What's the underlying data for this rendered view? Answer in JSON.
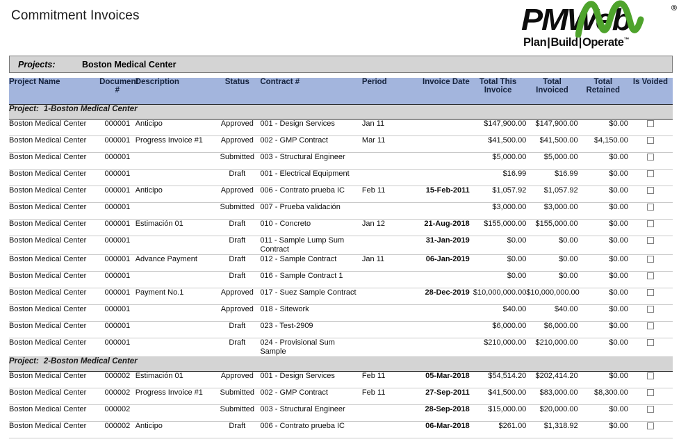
{
  "report": {
    "title": "Commitment Invoices"
  },
  "logo": {
    "wordmark": "PMWeb",
    "registered": "®",
    "tagline_plan": "Plan",
    "tagline_build": "Build",
    "tagline_operate": "Operate",
    "tagline_sep": "|",
    "trademark": "™"
  },
  "filter": {
    "label": "Projects:",
    "value": "Boston Medical Center"
  },
  "table": {
    "columns": [
      "Project Name",
      "Document #",
      "Description",
      "Status",
      "Contract #",
      "Period",
      "Invoice Date",
      "Total This Invoice",
      "Total Invoiced",
      "Total Retained",
      "Is Voided"
    ],
    "groups": [
      {
        "label": "Project:",
        "name": "1-Boston Medical Center",
        "rows": [
          {
            "project": "Boston Medical Center",
            "document": "000001",
            "description": "Anticipo",
            "status": "Approved",
            "contract": "001 - Design Services",
            "period": "Jan 11",
            "invoice_date": "",
            "total_this_invoice": "$147,900.00",
            "total_invoiced": "$147,900.00",
            "total_retained": "$0.00",
            "is_voided": false
          },
          {
            "project": "Boston Medical Center",
            "document": "000001",
            "description": "Progress Invoice #1",
            "status": "Approved",
            "contract": "002 - GMP Contract",
            "period": "Mar 11",
            "invoice_date": "",
            "total_this_invoice": "$41,500.00",
            "total_invoiced": "$41,500.00",
            "total_retained": "$4,150.00",
            "is_voided": false
          },
          {
            "project": "Boston Medical Center",
            "document": "000001",
            "description": "",
            "status": "Submitted",
            "contract": "003 - Structural Engineer",
            "period": "",
            "invoice_date": "",
            "total_this_invoice": "$5,000.00",
            "total_invoiced": "$5,000.00",
            "total_retained": "$0.00",
            "is_voided": false
          },
          {
            "project": "Boston Medical Center",
            "document": "000001",
            "description": "",
            "status": "Draft",
            "contract": "001 - Electrical Equipment",
            "period": "",
            "invoice_date": "",
            "total_this_invoice": "$16.99",
            "total_invoiced": "$16.99",
            "total_retained": "$0.00",
            "is_voided": false
          },
          {
            "project": "Boston Medical Center",
            "document": "000001",
            "description": "Anticipo",
            "status": "Approved",
            "contract": "006 - Contrato prueba IC",
            "period": "Feb 11",
            "invoice_date": "15-Feb-2011",
            "total_this_invoice": "$1,057.92",
            "total_invoiced": "$1,057.92",
            "total_retained": "$0.00",
            "is_voided": false
          },
          {
            "project": "Boston Medical Center",
            "document": "000001",
            "description": "",
            "status": "Submitted",
            "contract": "007 - Prueba validación",
            "period": "",
            "invoice_date": "",
            "total_this_invoice": "$3,000.00",
            "total_invoiced": "$3,000.00",
            "total_retained": "$0.00",
            "is_voided": false
          },
          {
            "project": "Boston Medical Center",
            "document": "000001",
            "description": "Estimación 01",
            "status": "Draft",
            "contract": "010 - Concreto",
            "period": "Jan 12",
            "invoice_date": "21-Aug-2018",
            "total_this_invoice": "$155,000.00",
            "total_invoiced": "$155,000.00",
            "total_retained": "$0.00",
            "is_voided": false
          },
          {
            "project": "Boston Medical Center",
            "document": "000001",
            "description": "",
            "status": "Draft",
            "contract": "011 - Sample Lump Sum Contract",
            "period": "",
            "invoice_date": "31-Jan-2019",
            "total_this_invoice": "$0.00",
            "total_invoiced": "$0.00",
            "total_retained": "$0.00",
            "is_voided": false
          },
          {
            "project": "Boston Medical Center",
            "document": "000001",
            "description": "Advance Payment",
            "status": "Draft",
            "contract": "012 - Sample Contract",
            "period": "Jan 11",
            "invoice_date": "06-Jan-2019",
            "total_this_invoice": "$0.00",
            "total_invoiced": "$0.00",
            "total_retained": "$0.00",
            "is_voided": false
          },
          {
            "project": "Boston Medical Center",
            "document": "000001",
            "description": "",
            "status": "Draft",
            "contract": "016 - Sample Contract 1",
            "period": "",
            "invoice_date": "",
            "total_this_invoice": "$0.00",
            "total_invoiced": "$0.00",
            "total_retained": "$0.00",
            "is_voided": false
          },
          {
            "project": "Boston Medical Center",
            "document": "000001",
            "description": "Payment No.1",
            "status": "Approved",
            "contract": "017 - Suez Sample Contract",
            "period": "",
            "invoice_date": "28-Dec-2019",
            "total_this_invoice": "$10,000,000.00",
            "total_invoiced": "$10,000,000.00",
            "total_retained": "$0.00",
            "is_voided": false
          },
          {
            "project": "Boston Medical Center",
            "document": "000001",
            "description": "",
            "status": "Approved",
            "contract": "018 - Sitework",
            "period": "",
            "invoice_date": "",
            "total_this_invoice": "$40.00",
            "total_invoiced": "$40.00",
            "total_retained": "$0.00",
            "is_voided": false
          },
          {
            "project": "Boston Medical Center",
            "document": "000001",
            "description": "",
            "status": "Draft",
            "contract": "023 - Test-2909",
            "period": "",
            "invoice_date": "",
            "total_this_invoice": "$6,000.00",
            "total_invoiced": "$6,000.00",
            "total_retained": "$0.00",
            "is_voided": false
          },
          {
            "project": "Boston Medical Center",
            "document": "000001",
            "description": "",
            "status": "Draft",
            "contract": "024 - Provisional Sum Sample",
            "period": "",
            "invoice_date": "",
            "total_this_invoice": "$210,000.00",
            "total_invoiced": "$210,000.00",
            "total_retained": "$0.00",
            "is_voided": false
          }
        ]
      },
      {
        "label": "Project:",
        "name": "2-Boston Medical Center",
        "rows": [
          {
            "project": "Boston Medical Center",
            "document": "000002",
            "description": "Estimación 01",
            "status": "Approved",
            "contract": "001 - Design Services",
            "period": "Feb 11",
            "invoice_date": "05-Mar-2018",
            "total_this_invoice": "$54,514.20",
            "total_invoiced": "$202,414.20",
            "total_retained": "$0.00",
            "is_voided": false
          },
          {
            "project": "Boston Medical Center",
            "document": "000002",
            "description": "Progress Invoice #1",
            "status": "Submitted",
            "contract": "002 - GMP Contract",
            "period": "Feb 11",
            "invoice_date": "27-Sep-2011",
            "total_this_invoice": "$41,500.00",
            "total_invoiced": "$83,000.00",
            "total_retained": "$8,300.00",
            "is_voided": false
          },
          {
            "project": "Boston Medical Center",
            "document": "000002",
            "description": "",
            "status": "Submitted",
            "contract": "003 - Structural Engineer",
            "period": "",
            "invoice_date": "28-Sep-2018",
            "total_this_invoice": "$15,000.00",
            "total_invoiced": "$20,000.00",
            "total_retained": "$0.00",
            "is_voided": false
          },
          {
            "project": "Boston Medical Center",
            "document": "000002",
            "description": "Anticipo",
            "status": "Draft",
            "contract": "006 - Contrato prueba IC",
            "period": "",
            "invoice_date": "06-Mar-2018",
            "total_this_invoice": "$261.00",
            "total_invoiced": "$1,318.92",
            "total_retained": "$0.00",
            "is_voided": false
          }
        ]
      }
    ]
  },
  "colors": {
    "header_bg": "#a3b5dd",
    "group_bg": "#d4d4d4",
    "logo_green": "#4ea32c",
    "row_border": "#c9c9c9"
  }
}
